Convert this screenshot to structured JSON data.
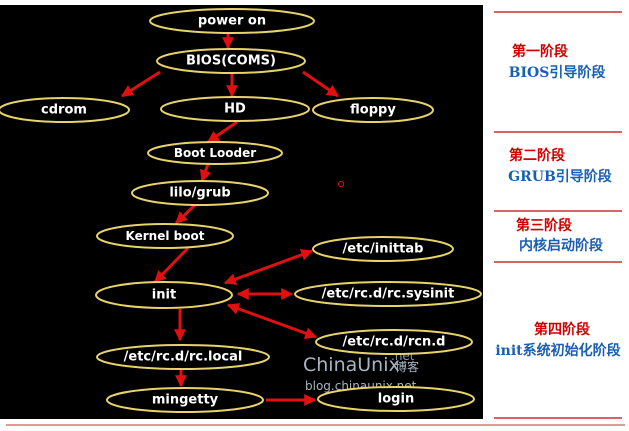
{
  "colors": {
    "background": "#000000",
    "node_border": "#e8d36a",
    "arrow": "#e01010",
    "stage_title": "#d00000",
    "stage_subtitle": "#1a5fb4",
    "watermark": "#a7b4c2"
  },
  "nodes": {
    "power_on": "power on",
    "bios": "BIOS(COMS)",
    "cdrom": "cdrom",
    "hd": "HD",
    "floppy": "floppy",
    "boot_loader": "Boot Looder",
    "lilo_grub": "lilo/grub",
    "kernel_boot": "Kernel boot",
    "init": "init",
    "etc_inittab": "/etc/inittab",
    "etc_rc_sysinit": "/etc/rc.d/rc.sysinit",
    "etc_rcn_d": "/etc/rc.d/rcn.d",
    "etc_rc_local": "/etc/rc.d/rc.local",
    "mingetty": "mingetty",
    "login": "login"
  },
  "stages": [
    {
      "title": "第一阶段",
      "subtitle": "BIOS引导阶段"
    },
    {
      "title": "第二阶段",
      "subtitle": "GRUB引导阶段"
    },
    {
      "title": "第三阶段",
      "subtitle": "内核启动阶段"
    },
    {
      "title": "第四阶段",
      "subtitle": "init系统初始化阶段"
    }
  ],
  "watermark": {
    "brand": "ChinaUnix",
    "suffix": ".net",
    "tag": "博客",
    "url": "blog.chinaunix.net"
  }
}
